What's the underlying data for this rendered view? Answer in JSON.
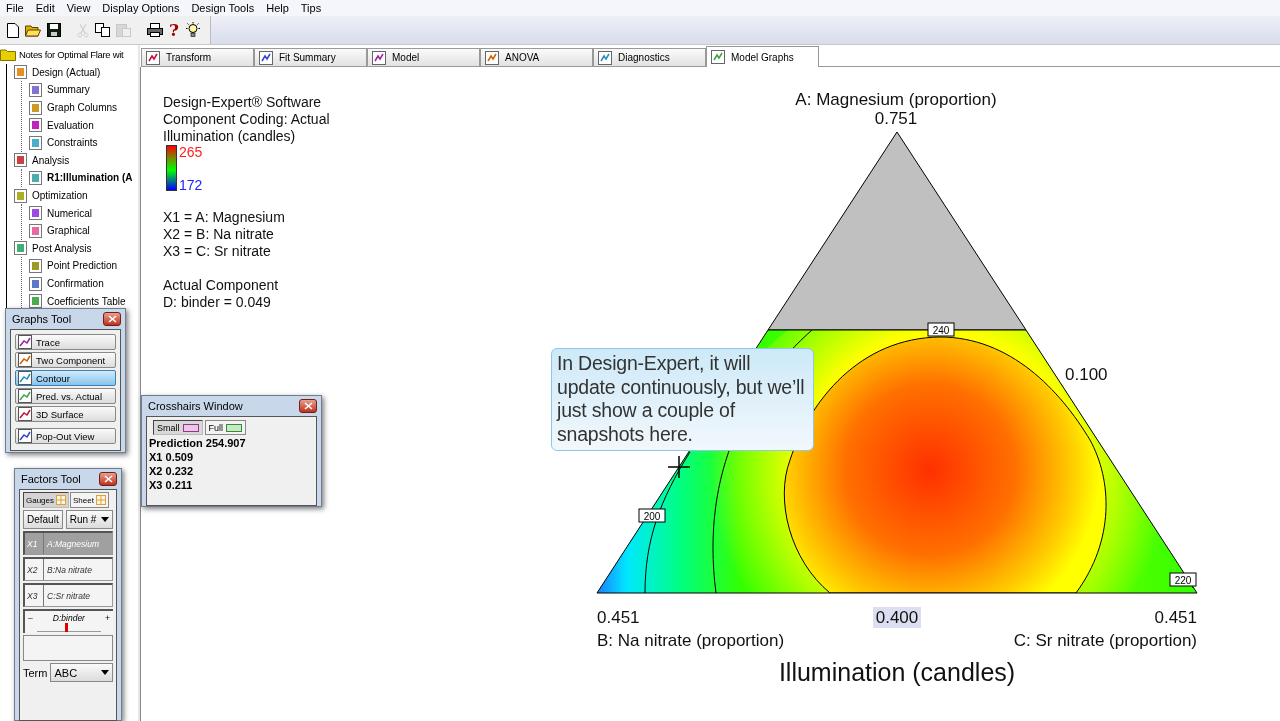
{
  "menu": [
    "File",
    "Edit",
    "View",
    "Display Options",
    "Design Tools",
    "Help",
    "Tips"
  ],
  "toolbar": [
    {
      "kind": "new",
      "disabled": false
    },
    {
      "kind": "open",
      "disabled": false
    },
    {
      "kind": "save",
      "disabled": false
    },
    {
      "kind": "cut",
      "disabled": true
    },
    {
      "kind": "copy",
      "disabled": false
    },
    {
      "kind": "paste",
      "disabled": true
    },
    {
      "kind": "print",
      "disabled": false
    },
    {
      "kind": "help",
      "label": "?",
      "disabled": false
    },
    {
      "kind": "tips",
      "disabled": false
    }
  ],
  "tree": {
    "label": "Notes for Optimal Flare wit",
    "selected": false,
    "children": [
      {
        "label": "Design (Actual)",
        "selected": false,
        "children": [
          {
            "label": "Summary",
            "selected": false
          },
          {
            "label": "Graph Columns",
            "selected": false
          },
          {
            "label": "Evaluation",
            "selected": false
          },
          {
            "label": "Constraints",
            "selected": false
          }
        ]
      },
      {
        "label": "Analysis",
        "selected": false,
        "children": [
          {
            "label": "R1:Illumination (A",
            "selected": true
          }
        ]
      },
      {
        "label": "Optimization",
        "selected": false,
        "children": [
          {
            "label": "Numerical",
            "selected": false
          },
          {
            "label": "Graphical",
            "selected": false
          }
        ]
      },
      {
        "label": "Post Analysis",
        "selected": false,
        "children": [
          {
            "label": "Point Prediction",
            "selected": false
          },
          {
            "label": "Confirmation",
            "selected": false
          },
          {
            "label": "Coefficients Table",
            "selected": false
          }
        ]
      }
    ]
  },
  "tabs": [
    {
      "label": "Transform",
      "selected": false
    },
    {
      "label": "Fit Summary",
      "selected": false
    },
    {
      "label": "Model",
      "selected": false
    },
    {
      "label": "ANOVA",
      "selected": false
    },
    {
      "label": "Diagnostics",
      "selected": false
    },
    {
      "label": "Model Graphs",
      "selected": true
    }
  ],
  "legend": {
    "lines": [
      "Design-Expert® Software",
      "Component Coding: Actual",
      "Illumination (candles)"
    ],
    "scale_max": "265",
    "scale_min": "172",
    "factors": [
      "X1 = A: Magnesium",
      "X2 = B: Na nitrate",
      "X3 = C: Sr nitrate"
    ],
    "component": [
      "Actual Component",
      "D: binder = 0.049"
    ]
  },
  "plot": {
    "top_axis_title": "A: Magnesium (proportion)",
    "top_value": "0.751",
    "right_value": "0.100",
    "left_value": "0.451",
    "center_value": "0.400",
    "right_end_value": "0.451",
    "left_axis_title": "B: Na nitrate (proportion)",
    "right_axis_title": "C: Sr nitrate (proportion)",
    "title": "Illumination (candles)",
    "contour_labels": [
      "240",
      "200",
      "220"
    ]
  },
  "callout": "In Design-Expert, it will update continuously, but we’ll just show a couple of snapshots here.",
  "graphs_tool": {
    "title": "Graphs Tool",
    "buttons": [
      {
        "label": "Trace",
        "selected": false
      },
      {
        "label": "Two Component",
        "selected": false
      },
      {
        "label": "Contour",
        "selected": true
      },
      {
        "label": "Pred. vs. Actual",
        "selected": false
      },
      {
        "label": "3D Surface",
        "selected": false
      },
      {
        "label": "Pop-Out View",
        "selected": false
      }
    ]
  },
  "crosshairs": {
    "title": "Crosshairs Window",
    "tabs": [
      {
        "label": "Small",
        "selected": true
      },
      {
        "label": "Full",
        "selected": false
      }
    ],
    "prediction": "Prediction 254.907",
    "values": [
      "X1 0.509",
      "X2 0.232",
      "X3 0.211"
    ]
  },
  "factors_tool": {
    "title": "Factors Tool",
    "tabs": [
      {
        "label": "Gauges",
        "selected": true
      },
      {
        "label": "Sheet",
        "selected": false
      }
    ],
    "default_button": "Default",
    "run_select": "Run #",
    "factors": [
      {
        "code": "X1",
        "name": "A:Magnesium",
        "selected": true
      },
      {
        "code": "X2",
        "name": "B:Na nitrate",
        "selected": false
      },
      {
        "code": "X3",
        "name": "C:Sr nitrate",
        "selected": false
      }
    ],
    "slider": {
      "label": "D:binder",
      "minus": "–",
      "plus": "+",
      "level": 0.43
    },
    "term_label": "Term",
    "term_value": "ABC"
  }
}
